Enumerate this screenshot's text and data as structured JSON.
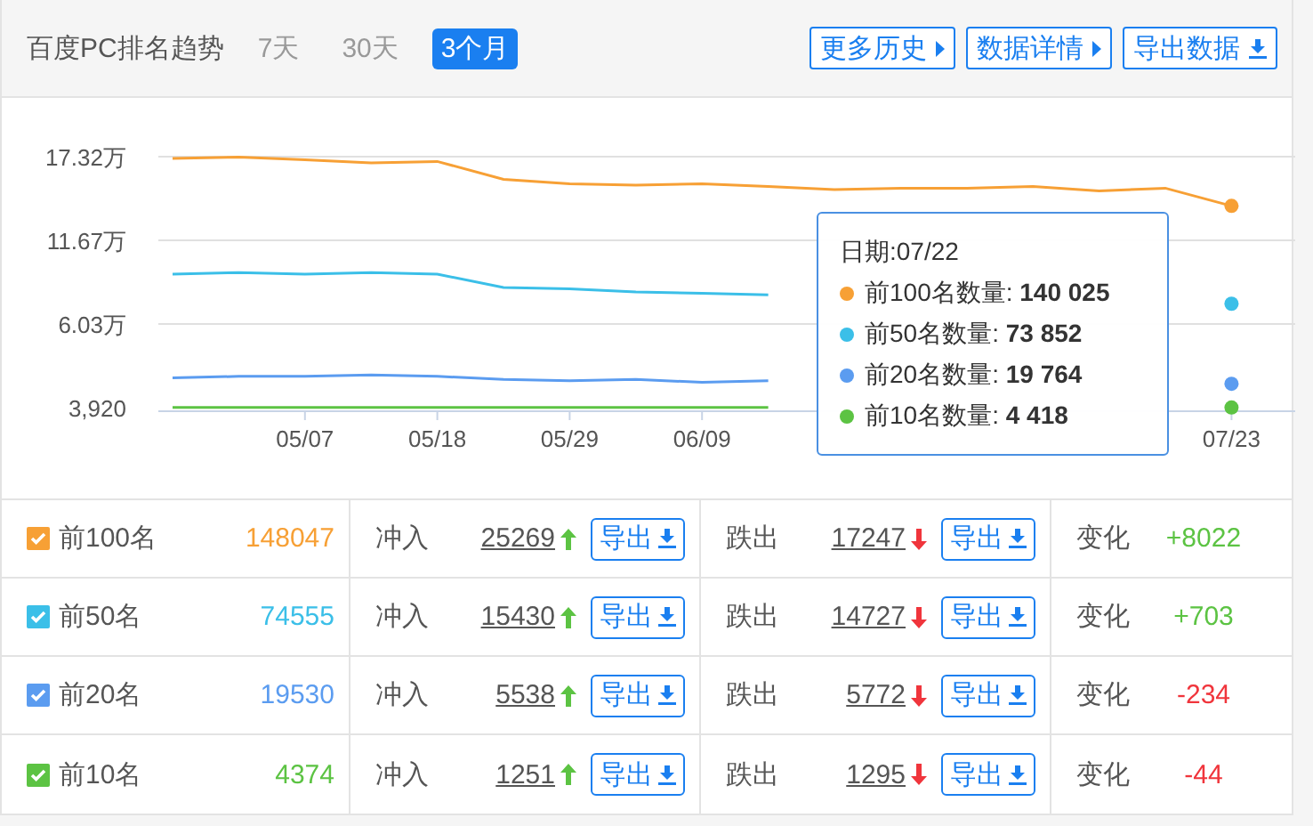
{
  "header": {
    "title": "百度PC排名趋势",
    "tabs": [
      {
        "label": "7天",
        "selected": false
      },
      {
        "label": "30天",
        "selected": false
      },
      {
        "label": "3个月",
        "selected": true
      }
    ],
    "buttons": [
      {
        "label": "更多历史",
        "kind": "caret"
      },
      {
        "label": "数据详情",
        "kind": "caret"
      },
      {
        "label": "导出数据",
        "kind": "download"
      }
    ]
  },
  "chart": {
    "chart_data": {
      "type": "line",
      "categories": [
        null,
        null,
        "05/07",
        null,
        "05/18",
        null,
        "05/29",
        null,
        "06/09",
        null,
        null,
        null,
        null,
        null,
        null,
        null,
        "07/23"
      ],
      "ylim": [
        0.392,
        17.32
      ],
      "yticks": [
        {
          "value": 6.03,
          "label": "6.03万"
        },
        {
          "value": 11.67,
          "label": "11.67万"
        },
        {
          "value": 17.32,
          "label": "17.32万"
        }
      ],
      "series": [
        {
          "color": "#f7a035",
          "values": [
            17.2,
            17.3,
            17.1,
            16.9,
            17.0,
            15.8,
            15.5,
            15.4,
            15.5,
            15.3,
            15.1,
            15.2,
            15.2,
            15.3,
            15.0,
            15.2,
            14.0
          ]
        },
        {
          "color": "#3bbfe8",
          "values": [
            9.4,
            9.5,
            9.4,
            9.5,
            9.4,
            8.5,
            8.4,
            8.2,
            8.1,
            8.0,
            null,
            null,
            null,
            null,
            null,
            null,
            7.4
          ]
        },
        {
          "color": "#5b9cf0",
          "values": [
            2.4,
            2.5,
            2.5,
            2.6,
            2.5,
            2.3,
            2.2,
            2.3,
            2.1,
            2.2,
            null,
            null,
            null,
            null,
            null,
            null,
            2.0
          ]
        },
        {
          "color": "#5cc343",
          "values": [
            0.4,
            0.4,
            0.4,
            0.4,
            0.4,
            0.4,
            0.4,
            0.4,
            0.4,
            0.4,
            null,
            null,
            null,
            null,
            null,
            null,
            0.4
          ]
        }
      ]
    },
    "axis_min_label": "3,920",
    "tooltip": {
      "date": "日期:07/22",
      "items": [
        {
          "label": "前100名数量:",
          "value": "140 025",
          "color": "#f7a035"
        },
        {
          "label": "前50名数量:",
          "value": "73 852",
          "color": "#3bbfe8"
        },
        {
          "label": "前20名数量:",
          "value": "19 764",
          "color": "#5b9cf0"
        },
        {
          "label": "前10名数量:",
          "value": "4 418",
          "color": "#5cc343"
        }
      ]
    }
  },
  "rows": [
    {
      "label": "前100名",
      "checked": true,
      "color": "#f7a035",
      "count": "148047",
      "in_label": "冲入",
      "in_value": "25269",
      "in_export": "导出",
      "out_label": "跌出",
      "out_value": "17247",
      "out_export": "导出",
      "change_label": "变化",
      "change": "+8022",
      "rising": true
    },
    {
      "label": "前50名",
      "checked": true,
      "color": "#3bbfe8",
      "count": "74555",
      "in_label": "冲入",
      "in_value": "15430",
      "in_export": "导出",
      "out_label": "跌出",
      "out_value": "14727",
      "out_export": "导出",
      "change_label": "变化",
      "change": "+703",
      "rising": true
    },
    {
      "label": "前20名",
      "checked": true,
      "color": "#5b9cf0",
      "count": "19530",
      "in_label": "冲入",
      "in_value": "5538",
      "in_export": "导出",
      "out_label": "跌出",
      "out_value": "5772",
      "out_export": "导出",
      "change_label": "变化",
      "change": "-234",
      "rising": false
    },
    {
      "label": "前10名",
      "checked": true,
      "color": "#5cc343",
      "count": "4374",
      "in_label": "冲入",
      "in_value": "1251",
      "in_export": "导出",
      "out_label": "跌出",
      "out_value": "1295",
      "out_export": "导出",
      "change_label": "变化",
      "change": "-44",
      "rising": false
    }
  ]
}
